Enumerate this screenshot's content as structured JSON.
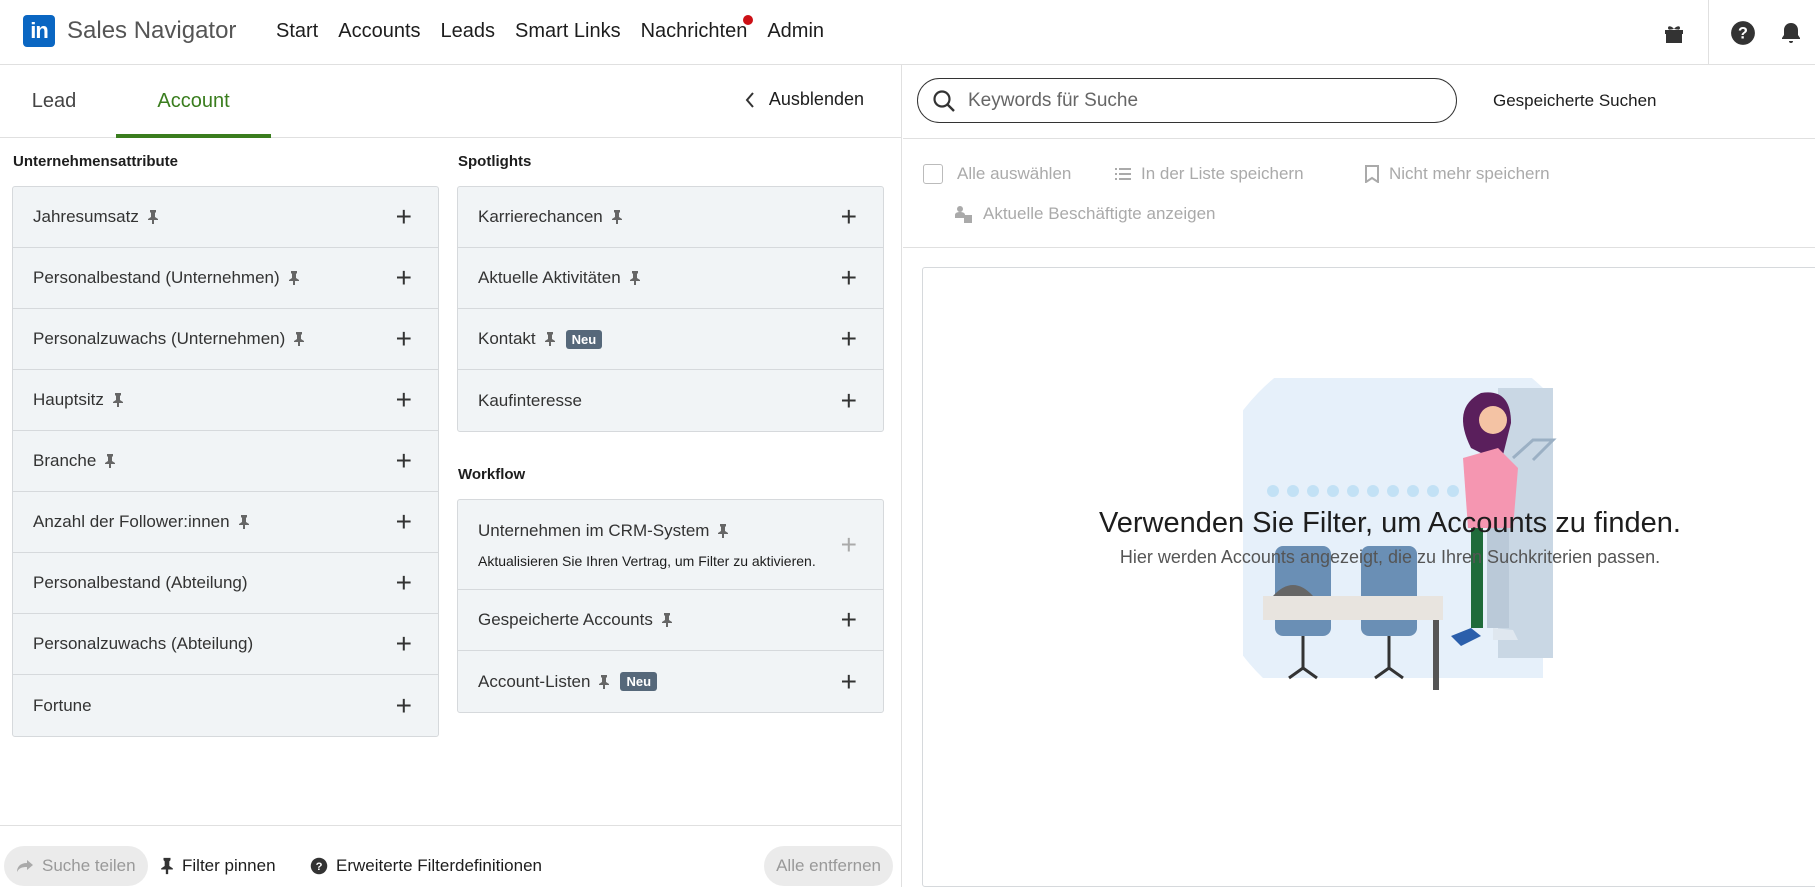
{
  "nav": {
    "logo_text": "in",
    "brand": "Sales Navigator",
    "links": [
      "Start",
      "Accounts",
      "Leads",
      "Smart Links",
      "Nachrichten",
      "Admin"
    ]
  },
  "tabs": {
    "lead": "Lead",
    "account": "Account"
  },
  "hide_label": "Ausblenden",
  "sections": {
    "company_attributes": "Unternehmensattribute",
    "spotlights": "Spotlights",
    "workflow": "Workflow"
  },
  "company_filters": [
    "Jahresumsatz",
    "Personalbestand (Unternehmen)",
    "Personalzuwachs (Unternehmen)",
    "Hauptsitz",
    "Branche",
    "Anzahl der Follower:innen",
    "Personalbestand (Abteilung)",
    "Personalzuwachs (Abteilung)",
    "Fortune"
  ],
  "spotlight_filters": [
    "Karrierechancen",
    "Aktuelle Aktivitäten",
    "Kontakt",
    "Kaufinteresse"
  ],
  "workflow_filters": {
    "crm": "Unternehmen im CRM-System",
    "crm_hint": "Aktualisieren Sie Ihren Vertrag, um Filter zu aktivieren.",
    "saved": "Gespeicherte Accounts",
    "lists": "Account-Listen"
  },
  "badge_new": "Neu",
  "bottom": {
    "share": "Suche teilen",
    "pin": "Filter pinnen",
    "definitions": "Erweiterte Filterdefinitionen",
    "remove_all": "Alle entfernen"
  },
  "search": {
    "placeholder": "Keywords für Suche",
    "saved_searches": "Gespeicherte Suchen"
  },
  "toolbar": {
    "select_all": "Alle auswählen",
    "save_to_list": "In der Liste speichern",
    "unsave": "Nicht mehr speichern",
    "show_employees": "Aktuelle Beschäftigte anzeigen"
  },
  "empty_state": {
    "title": "Verwenden Sie Filter, um Accounts zu finden.",
    "subtitle": "Hier werden Accounts angezeigt, die zu Ihren Suchkriterien passen."
  },
  "colors": {
    "brand_blue": "#0a66c2",
    "active_tab_green": "#3a7d1e",
    "notification_red": "#cc1016",
    "badge_gray": "#56687a"
  }
}
